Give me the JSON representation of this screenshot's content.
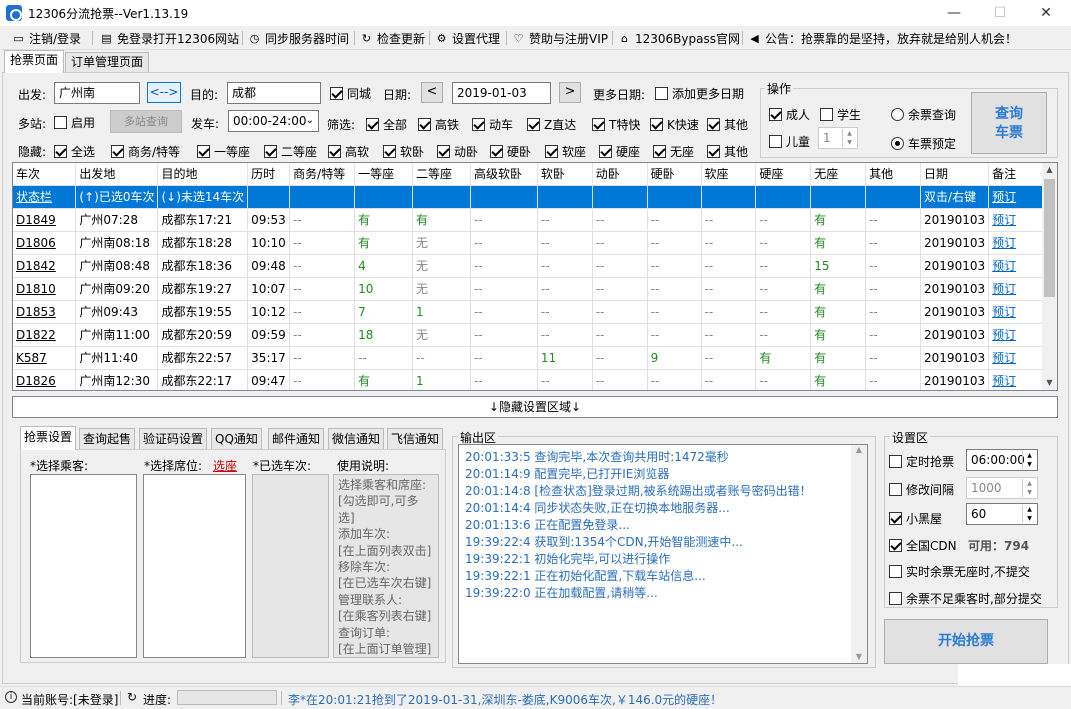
{
  "window": {
    "title": "12306分流抢票--Ver1.13.19",
    "minimize": "—",
    "maximize": "☐",
    "close": "✕"
  },
  "menu": {
    "login": "注销/登录",
    "open_site": "免登录打开12306网站",
    "sync_time": "同步服务器时间",
    "check_update": "检查更新",
    "proxy": "设置代理",
    "sponsor": "赞助与注册VIP",
    "bypass_site": "12306Bypass官网",
    "notice": "公告：抢票靠的是坚持，放弃就是给别人机会！"
  },
  "tabs": {
    "grab": "抢票页面",
    "orders": "订单管理页面"
  },
  "query": {
    "from_label": "出发:",
    "from_value": "广州南",
    "swap": "<-->",
    "to_label": "目的:",
    "to_value": "成都",
    "same_city": "同城",
    "date_label": "日期:",
    "date_value": "2019-01-03",
    "prev": "<",
    "next": ">",
    "more_dates_label": "更多日期:",
    "add_more_dates": "添加更多日期",
    "multi_label": "多站:",
    "enable": "启用",
    "multi_query": "多站查询",
    "depart_label": "发车:",
    "depart_value": "00:00-24:00",
    "filter_label": "筛选:",
    "filters": [
      "全部",
      "高铁",
      "动车",
      "Z直达",
      "T特快",
      "K快速",
      "其他"
    ],
    "hide_label": "隐藏:",
    "hides": [
      "全选",
      "商务/特等",
      "一等座",
      "二等座",
      "高软",
      "软卧",
      "动卧",
      "硬卧",
      "软座",
      "硬座",
      "无座",
      "其他"
    ]
  },
  "ops": {
    "title": "操作",
    "adult": "成人",
    "student": "学生",
    "child": "儿童",
    "child_count": "1",
    "remain_query": "余票查询",
    "book": "车票预定",
    "query_btn_1": "查询",
    "query_btn_2": "车票"
  },
  "grid": {
    "headers": [
      "车次",
      "出发地",
      "目的地",
      "历时",
      "商务/特等",
      "一等座",
      "二等座",
      "高级软卧",
      "软卧",
      "动卧",
      "硬卧",
      "软座",
      "硬座",
      "无座",
      "其他",
      "日期",
      "备注"
    ],
    "status_row": [
      "状态栏",
      "(↑)已选0车次",
      "(↓)未选14车次",
      "",
      "",
      "",
      "",
      "",
      "",
      "",
      "",
      "",
      "",
      "",
      "",
      "双击/右键",
      "预订"
    ],
    "rows": [
      [
        "D1849",
        "广州07:28",
        "成都东17:21",
        "09:53",
        "--",
        "有",
        "有",
        "--",
        "--",
        "--",
        "--",
        "--",
        "--",
        "有",
        "--",
        "20190103",
        "预订"
      ],
      [
        "D1806",
        "广州南08:18",
        "成都东18:28",
        "10:10",
        "--",
        "有",
        "无",
        "--",
        "--",
        "--",
        "--",
        "--",
        "--",
        "有",
        "--",
        "20190103",
        "预订"
      ],
      [
        "D1842",
        "广州南08:48",
        "成都东18:36",
        "09:48",
        "--",
        "4",
        "无",
        "--",
        "--",
        "--",
        "--",
        "--",
        "--",
        "15",
        "--",
        "20190103",
        "预订"
      ],
      [
        "D1810",
        "广州南09:20",
        "成都东19:27",
        "10:07",
        "--",
        "10",
        "无",
        "--",
        "--",
        "--",
        "--",
        "--",
        "--",
        "有",
        "--",
        "20190103",
        "预订"
      ],
      [
        "D1853",
        "广州09:43",
        "成都东19:55",
        "10:12",
        "--",
        "7",
        "1",
        "--",
        "--",
        "--",
        "--",
        "--",
        "--",
        "有",
        "--",
        "20190103",
        "预订"
      ],
      [
        "D1822",
        "广州南11:00",
        "成都东20:59",
        "09:59",
        "--",
        "18",
        "无",
        "--",
        "--",
        "--",
        "--",
        "--",
        "--",
        "有",
        "--",
        "20190103",
        "预订"
      ],
      [
        "K587",
        "广州11:40",
        "成都东22:57",
        "35:17",
        "--",
        "--",
        "--",
        "--",
        "11",
        "--",
        "9",
        "--",
        "有",
        "有",
        "--",
        "20190103",
        "预订"
      ],
      [
        "D1826",
        "广州南12:30",
        "成都东22:17",
        "09:47",
        "--",
        "有",
        "1",
        "--",
        "--",
        "--",
        "--",
        "--",
        "--",
        "有",
        "--",
        "20190103",
        "预订"
      ]
    ]
  },
  "hide_settings": "↓隐藏设置区域↓",
  "bottom_tabs": [
    "抢票设置",
    "查询起售",
    "验证码设置",
    "QQ通知",
    "邮件通知",
    "微信通知",
    "飞信通知"
  ],
  "grab_settings": {
    "passenger_label": "*选择乘客:",
    "seat_label": "*选择席位:",
    "seat_link": "选座",
    "selected_trains": "*已选车次:",
    "usage_title": "使用说明:",
    "usage_lines": [
      "选择乘客和席座:",
      "[勾选即可,可多选]",
      "添加车次:",
      "[在上面列表双击]",
      "移除车次:",
      "[在已选车次右键]",
      "管理联系人:",
      "[在乘客列表右键]",
      "查询订单:",
      "[在上面订单管理]"
    ]
  },
  "output": {
    "title": "输出区",
    "lines": [
      "20:01:33:5  查询完毕,本次查询共用时:1472毫秒",
      "20:01:14:9  配置完毕,已打开IE浏览器",
      "20:01:14:8  [检查状态]登录过期,被系统踢出或者账号密码出错！",
      "20:01:14:4  同步状态失败,正在切换本地服务器...",
      "20:01:13:6  正在配置免登录...",
      "19:39:22:4  获取到:1354个CDN,开始智能测速中...",
      "19:39:22:1  初始化完毕,可以进行操作",
      "19:39:22:1  正在初始化配置,下载车站信息...",
      "19:39:22:0  正在加载配置,请稍等..."
    ]
  },
  "settings": {
    "title": "设置区",
    "timed": "定时抢票",
    "timed_value": "06:00:00",
    "interval": "修改间隔",
    "interval_value": "1000",
    "blackroom": "小黑屋",
    "blackroom_value": "60",
    "cdn": "全国CDN",
    "cdn_avail": "可用：794",
    "no_seat": "实时余票无座时,不提交",
    "partial": "余票不足乘客时,部分提交",
    "start": "开始抢票"
  },
  "status": {
    "account": "当前账号:[未登录]",
    "progress": "进度:",
    "ticker": "李*在20:01:21抢到了2019-01-31,深圳东-娄底,K9006车次,￥146.0元的硬座！"
  }
}
